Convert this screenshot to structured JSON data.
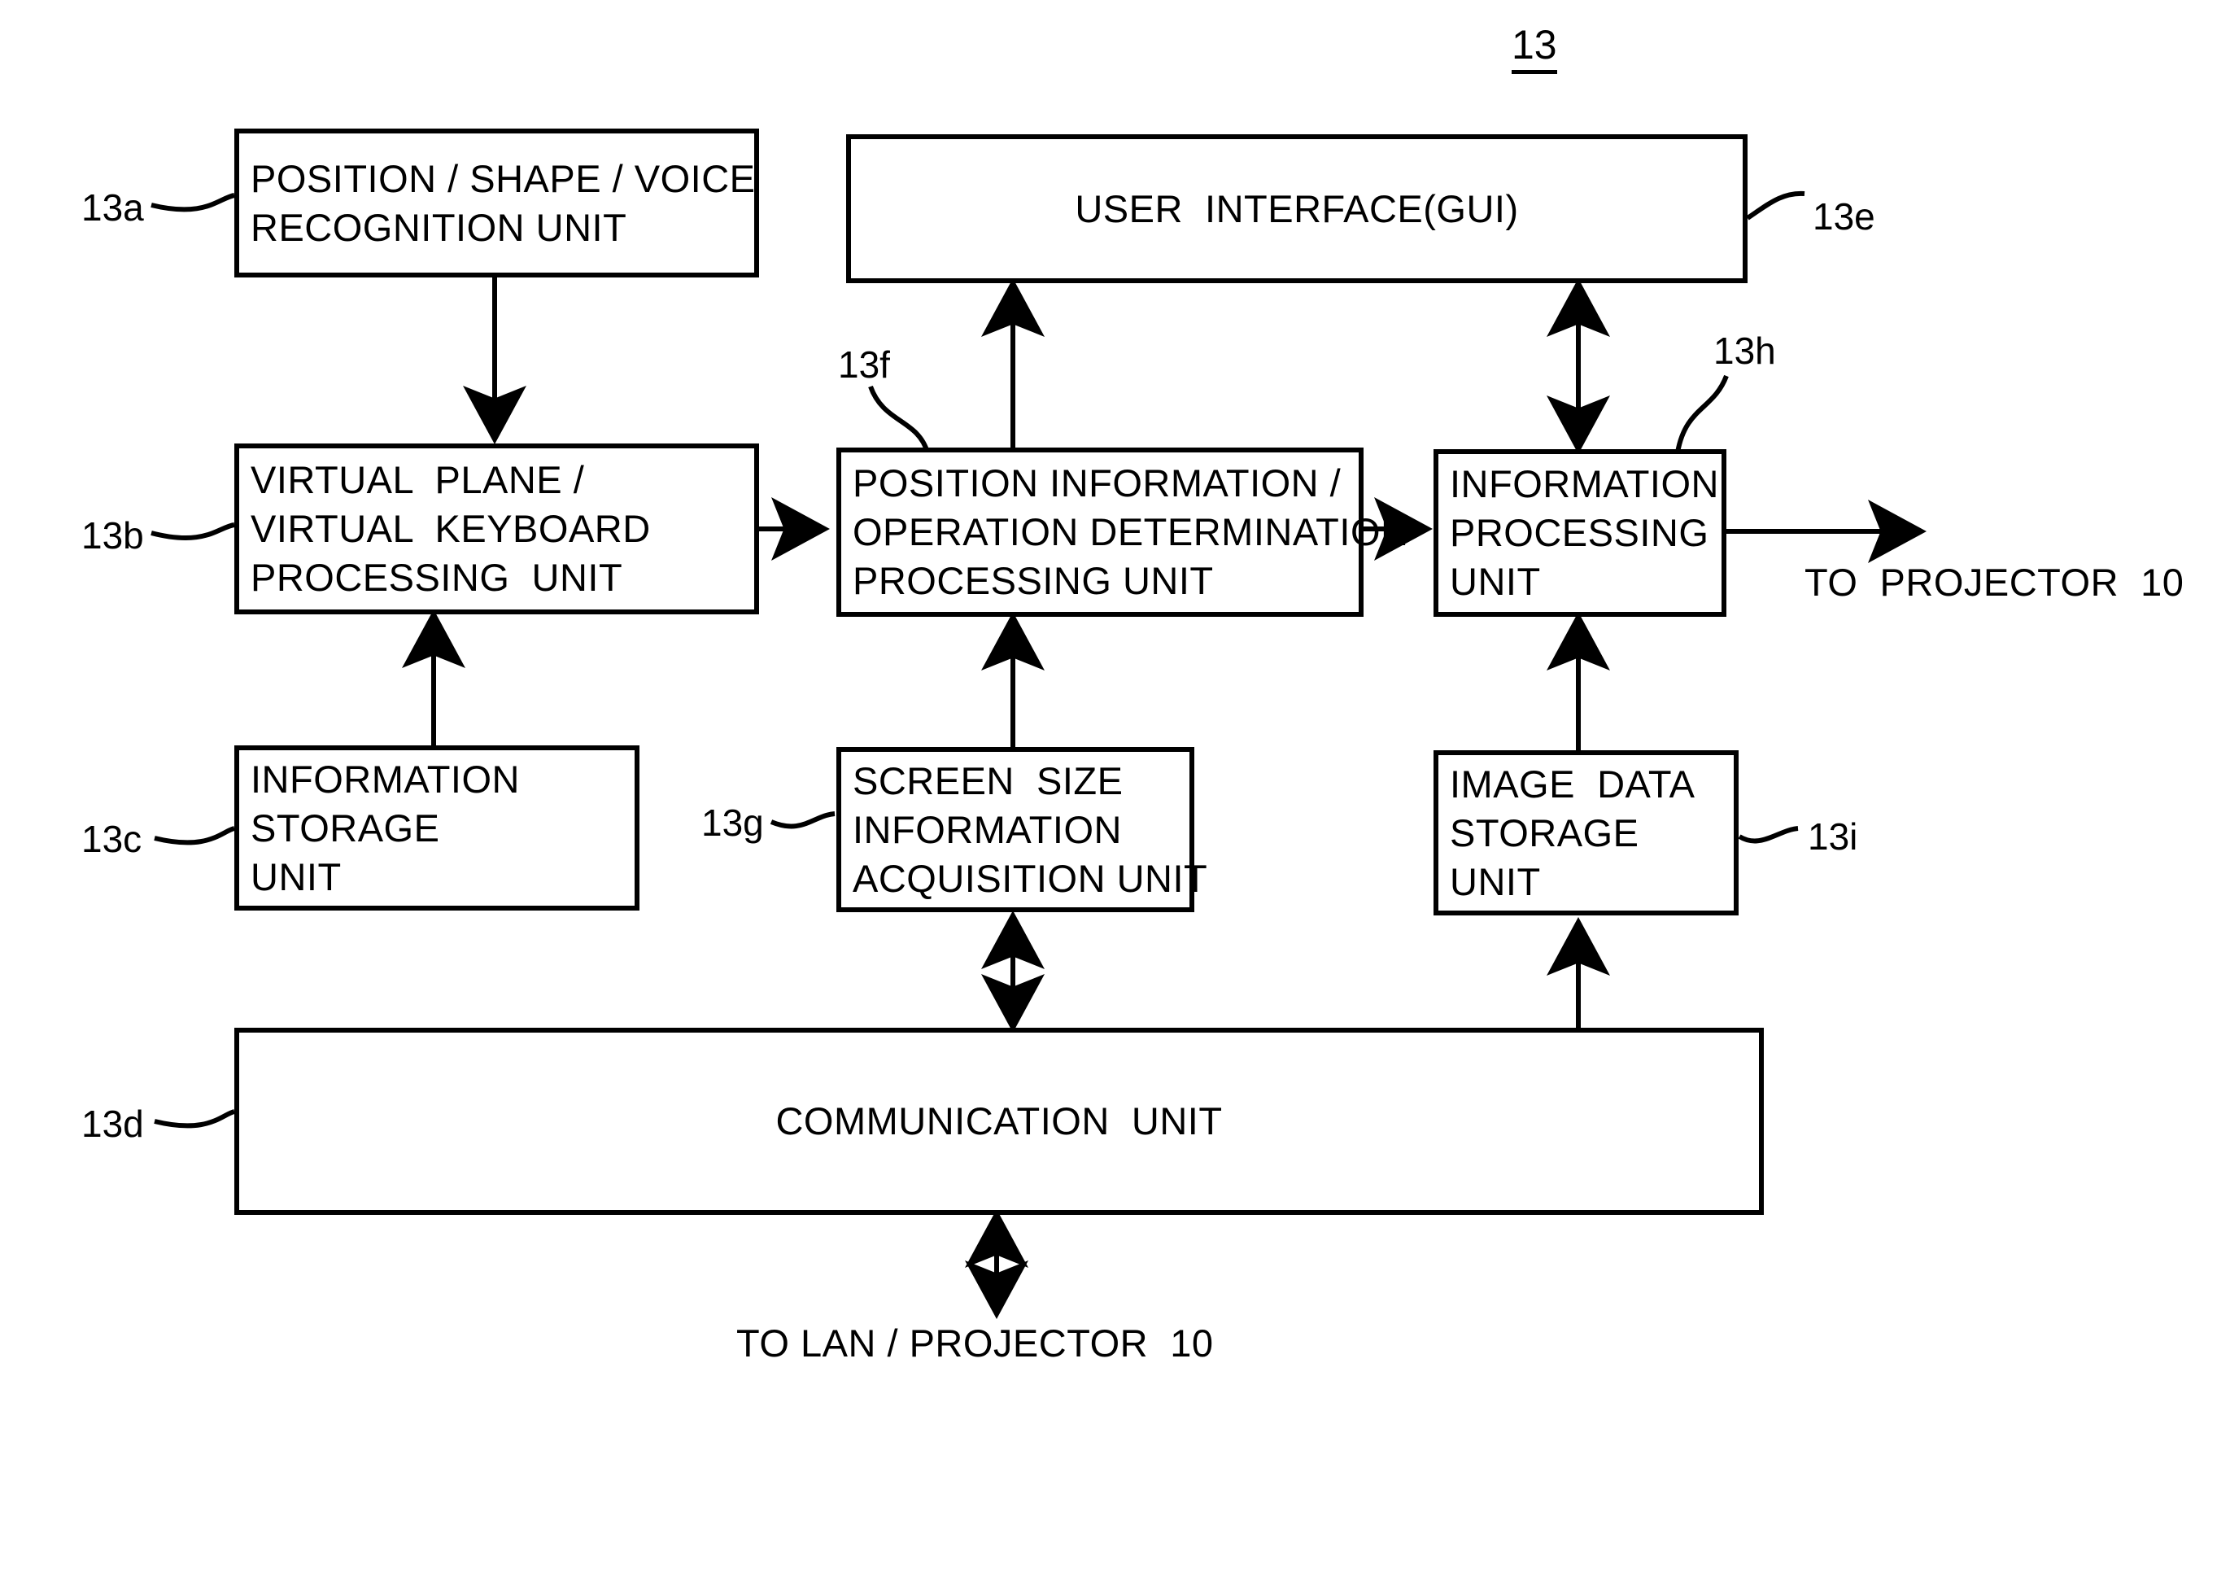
{
  "figure": {
    "number": "13",
    "type": "patent-block-diagram"
  },
  "blocks": [
    {
      "id": "13a",
      "ref": "13a",
      "lines": [
        "POSITION / SHAPE / VOICE",
        "RECOGNITION UNIT"
      ],
      "align": "left"
    },
    {
      "id": "13e",
      "ref": "13e",
      "lines": [
        "USER  INTERFACE(GUI)"
      ],
      "align": "center"
    },
    {
      "id": "13b",
      "ref": "13b",
      "lines": [
        "VIRTUAL  PLANE /",
        "VIRTUAL  KEYBOARD",
        "PROCESSING  UNIT"
      ],
      "align": "left"
    },
    {
      "id": "13f",
      "ref": "13f",
      "lines": [
        "POSITION INFORMATION /",
        "OPERATION DETERMINATION",
        "PROCESSING UNIT"
      ],
      "align": "left"
    },
    {
      "id": "13h",
      "ref": "13h",
      "lines": [
        "INFORMATION",
        "PROCESSING",
        "UNIT"
      ],
      "align": "left"
    },
    {
      "id": "13c",
      "ref": "13c",
      "lines": [
        "INFORMATION",
        "STORAGE",
        "UNIT"
      ],
      "align": "left"
    },
    {
      "id": "13g",
      "ref": "13g",
      "lines": [
        "SCREEN  SIZE",
        "INFORMATION",
        "ACQUISITION UNIT"
      ],
      "align": "left"
    },
    {
      "id": "13i",
      "ref": "13i",
      "lines": [
        "IMAGE  DATA",
        "STORAGE",
        "UNIT"
      ],
      "align": "left"
    },
    {
      "id": "13d",
      "ref": "13d",
      "lines": [
        "COMMUNICATION  UNIT"
      ],
      "align": "center"
    }
  ],
  "edge_labels": {
    "to_projector": "TO  PROJECTOR  10",
    "to_lan_projector": "TO LAN / PROJECTOR  10"
  },
  "colors": {
    "stroke": "#000000",
    "background": "#ffffff"
  }
}
